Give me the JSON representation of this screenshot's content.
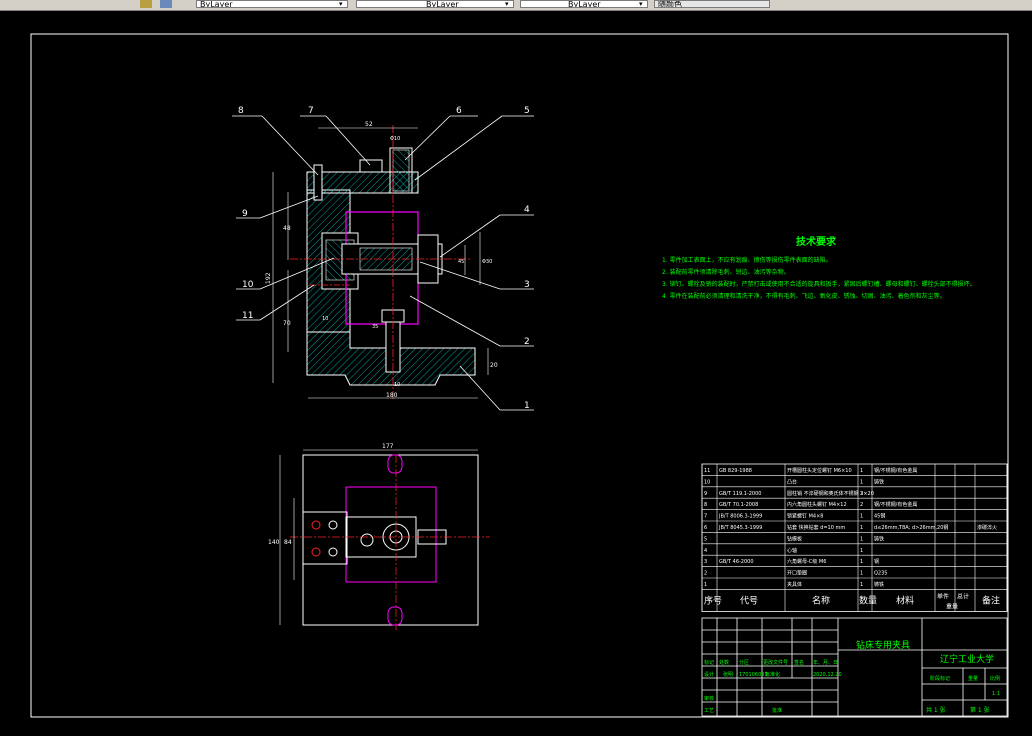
{
  "toolbar": {
    "color_control": "ByLayer",
    "linetype_control": "ByLayer",
    "lineweight_control": "ByLayer",
    "plotstyle_control": "随颜色"
  },
  "balloons": [
    "8",
    "7",
    "6",
    "5",
    "9",
    "4",
    "10",
    "3",
    "11",
    "2",
    "1"
  ],
  "dims": {
    "top_width": "52",
    "top_small": "Φ10",
    "left_height": "192",
    "left_mid": "48",
    "left_low": "70",
    "right_a": "45",
    "right_b": "Φ30",
    "base_height": "20",
    "bottom_width": "180",
    "mid_a": "10",
    "mid_b": "35",
    "mid_c": "10",
    "plan_width": "177",
    "plan_height": "140",
    "plan_inner": "84"
  },
  "tech": {
    "title": "技术要求",
    "lines": [
      "1. 零件加工表面上，不应有划痕、擦伤等损伤零件表面的缺陷。",
      "2. 装配前零件须清除毛刺、锐边、油污等杂物。",
      "3. 铆钉、螺栓及销的装配时，严禁打击或使用不合适的旋具和扳手，紧固后螺钉槽、螺母和螺钉、螺栓头部不得损坏。",
      "4. 零件在装配前必须清理和清洗干净，不得有毛刺、飞边、氧化皮、锈蚀、切屑、油污、着色剂和灰尘等。"
    ]
  },
  "bom": {
    "rows": [
      [
        "11",
        "GB 829-1988",
        "开槽圆柱头定位螺钉 M6×10",
        "1",
        "钢/不锈钢/有色金属",
        ""
      ],
      [
        "10",
        "",
        "凸台",
        "1",
        "铸铁",
        ""
      ],
      [
        "9",
        "GB/T 119.1-2000",
        "圆柱销 不淬硬钢和奥氏体不锈钢 3×20",
        "2",
        "",
        ""
      ],
      [
        "8",
        "GB/T 70.1-2008",
        "内六角圆柱头螺钉 M4×12",
        "2",
        "钢/不锈钢/有色金属",
        ""
      ],
      [
        "7",
        "JB/T 8006.3-1999",
        "锁紧螺钉 M4×8",
        "1",
        "45钢",
        ""
      ],
      [
        "6",
        "JB/T 8045.3-1999",
        "钻套 快换钻套 d=10 mm",
        "1",
        "d≤26mm,T8A; d>26mm,20钢",
        "渗碳淬火"
      ],
      [
        "5",
        "",
        "钻模板",
        "1",
        "铸铁",
        ""
      ],
      [
        "4",
        "",
        "心轴",
        "1",
        "",
        ""
      ],
      [
        "3",
        "GB/T 46-2000",
        "六角螺母-C级 M6",
        "1",
        "钢",
        ""
      ],
      [
        "2",
        "",
        "开口垫圈",
        "1",
        "Q235",
        ""
      ],
      [
        "1",
        "",
        "夹具体",
        "1",
        "铸铁",
        ""
      ]
    ],
    "header": {
      "seq": "序号",
      "code": "代号",
      "name": "名称",
      "qty": "数量",
      "material": "材料",
      "single": "单件",
      "total": "总计",
      "weight": "重量",
      "remark": "备注"
    }
  },
  "titleblock": {
    "drawing_title": "钻床专用夹具",
    "school": "辽宁工业大学",
    "row_labels": [
      "标记",
      "处数",
      "分区",
      "更改文件号",
      "签名",
      "年、月、日"
    ],
    "design_label": "设计",
    "designer": "张明",
    "std_label": "标准化",
    "student_id": "170106033",
    "date": "2020.12.20",
    "stage_label": "阶段标记",
    "weight_label": "重量",
    "scale_label": "比例",
    "scale": "1:1",
    "review_label": "审核",
    "process_label": "工艺",
    "approve_label": "批准",
    "sheets": "共 1 张",
    "sheet_no": "第 1 张"
  }
}
